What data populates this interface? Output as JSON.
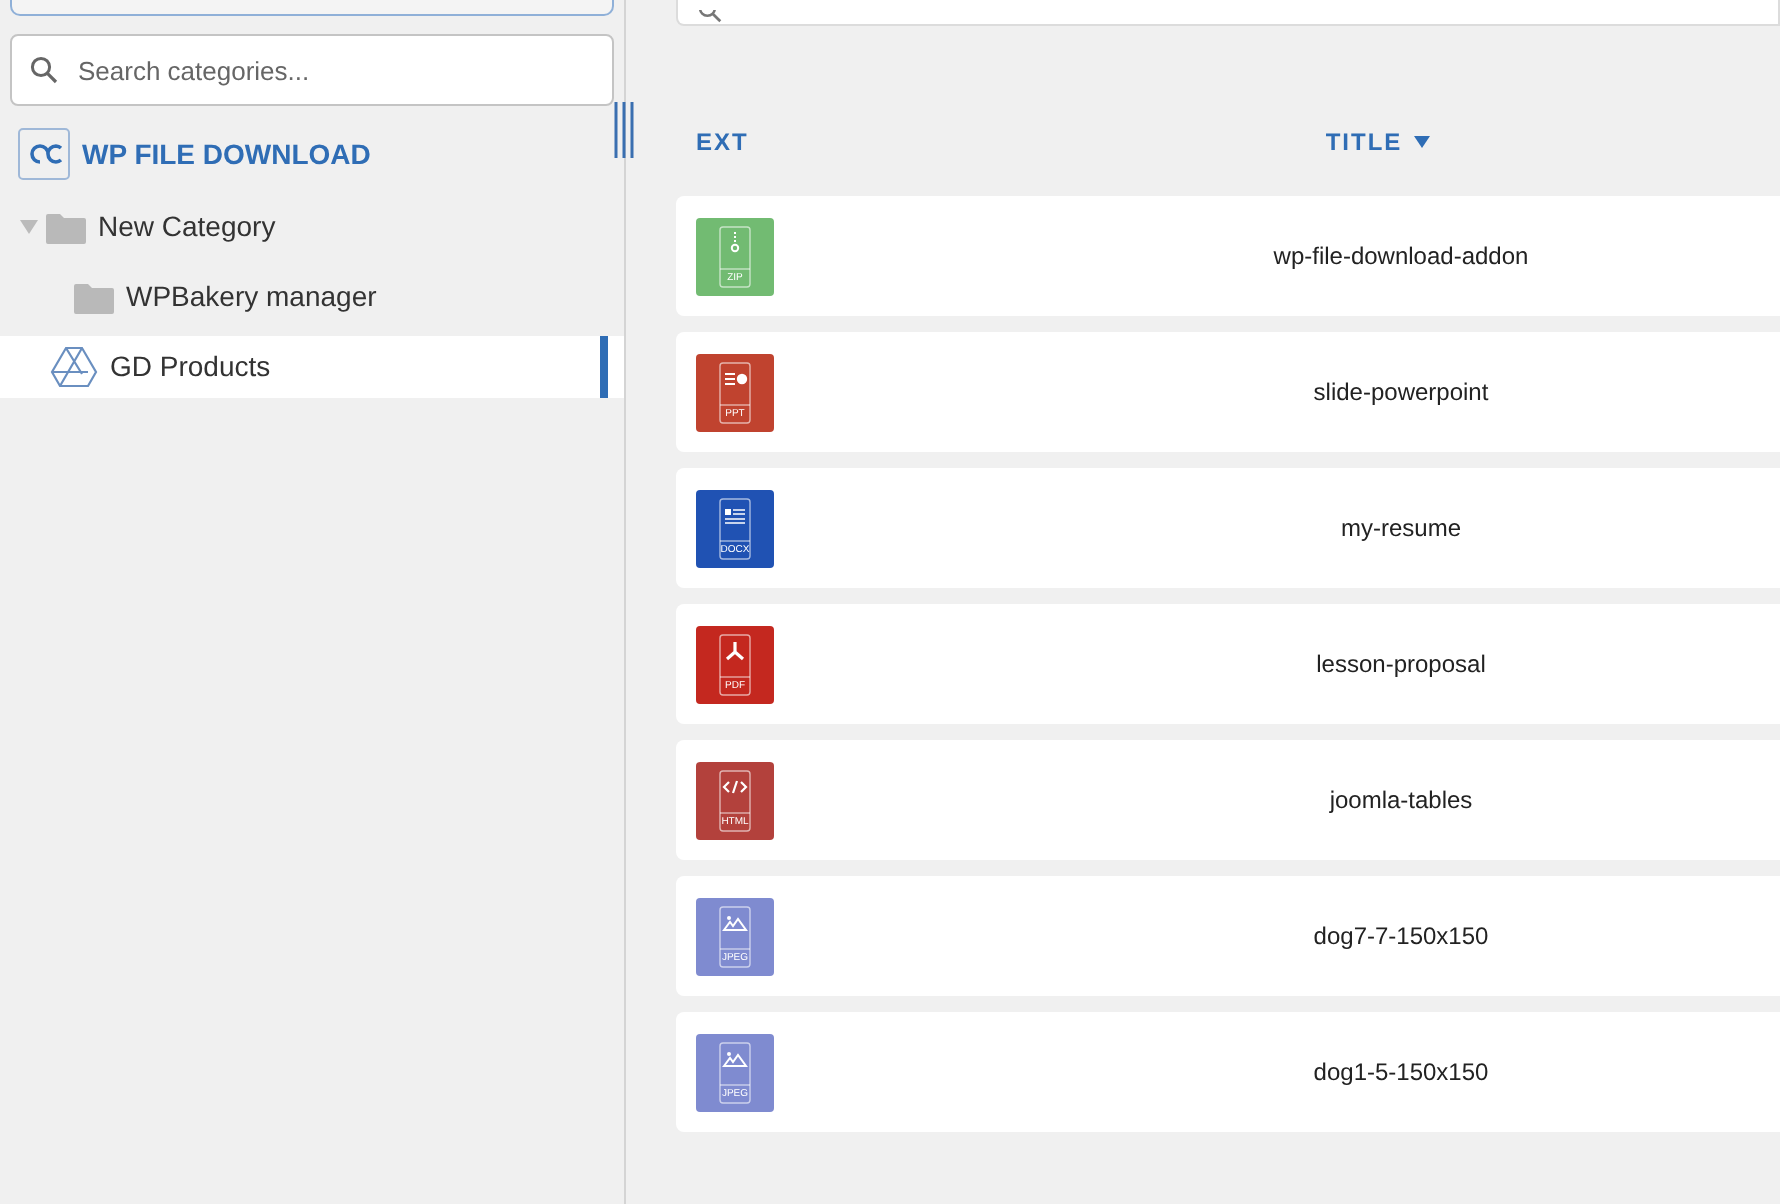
{
  "sidebar": {
    "search": {
      "placeholder": "Search categories..."
    },
    "brand": "WP FILE DOWNLOAD",
    "tree": [
      {
        "label": "New Category",
        "kind": "folder",
        "expanded": true,
        "selected": false,
        "children": [
          {
            "label": "WPBakery manager",
            "kind": "folder",
            "selected": false
          }
        ]
      },
      {
        "label": "GD Products",
        "kind": "drive",
        "selected": true
      }
    ]
  },
  "table": {
    "columns": [
      {
        "label": "EXT",
        "sorted": false
      },
      {
        "label": "TITLE",
        "sorted": true
      }
    ],
    "rows": [
      {
        "ext": "ZIP",
        "kind": "zip",
        "color": "#72bb72",
        "title": "wp-file-download-addon"
      },
      {
        "ext": "PPT",
        "kind": "ppt",
        "color": "#c0432f",
        "title": "slide-powerpoint"
      },
      {
        "ext": "DOCX",
        "kind": "docx",
        "color": "#2052b3",
        "title": "my-resume"
      },
      {
        "ext": "PDF",
        "kind": "pdf",
        "color": "#c4281f",
        "title": "lesson-proposal"
      },
      {
        "ext": "HTML",
        "kind": "html",
        "color": "#b3413c",
        "title": "joomla-tables"
      },
      {
        "ext": "JPEG",
        "kind": "jpeg",
        "color": "#7f8bd0",
        "title": "dog7-7-150x150"
      },
      {
        "ext": "JPEG",
        "kind": "jpeg",
        "color": "#7f8bd0",
        "title": "dog1-5-150x150"
      }
    ]
  }
}
